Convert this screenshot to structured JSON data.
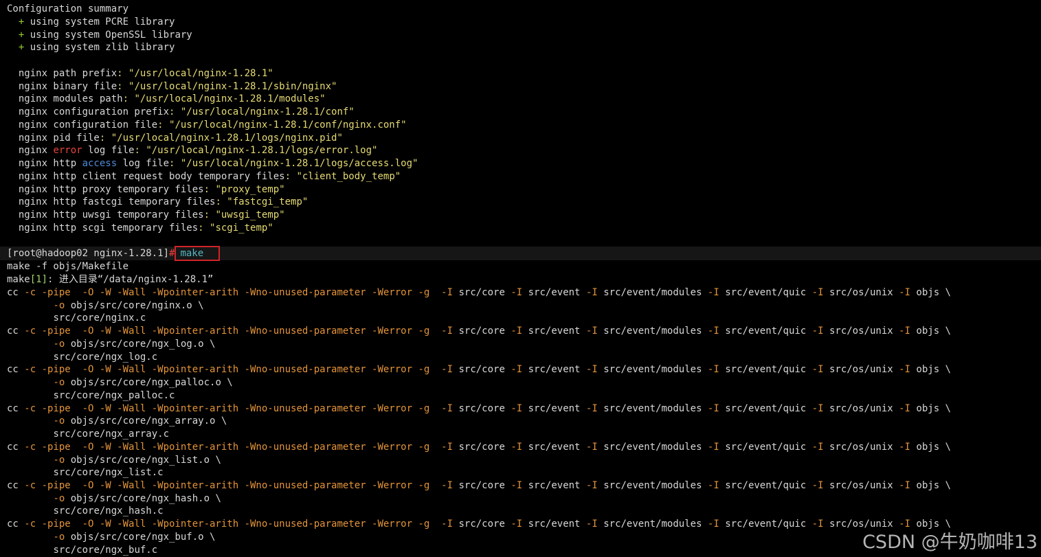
{
  "summary": {
    "title": "Configuration summary",
    "plus": "+",
    "libs": [
      "using system PCRE library",
      "using system OpenSSL library",
      "using system zlib library"
    ]
  },
  "config": {
    "path_prefix_label": "nginx path prefix",
    "path_prefix_value": "\"/usr/local/nginx-1.28.1\"",
    "binary_label": "nginx binary file",
    "binary_value": "\"/usr/local/nginx-1.28.1/sbin/nginx\"",
    "modules_label": "nginx modules path",
    "modules_value": "\"/usr/local/nginx-1.28.1/modules\"",
    "conf_prefix_label": "nginx configuration prefix",
    "conf_prefix_value": "\"/usr/local/nginx-1.28.1/conf\"",
    "conf_file_label": "nginx configuration file",
    "conf_file_value": "\"/usr/local/nginx-1.28.1/conf/nginx.conf\"",
    "pid_label": "nginx pid file",
    "pid_value": "\"/usr/local/nginx-1.28.1/logs/nginx.pid\"",
    "error_pre": "nginx ",
    "error_word": "error",
    "error_post": " log file",
    "error_value": "\"/usr/local/nginx-1.28.1/logs/error.log\"",
    "access_pre": "nginx http ",
    "access_word": "access",
    "access_post": " log file",
    "access_value": "\"/usr/local/nginx-1.28.1/logs/access.log\"",
    "client_body_label": "nginx http client request body temporary files",
    "client_body_value": "\"client_body_temp\"",
    "proxy_label": "nginx http proxy temporary files",
    "proxy_value": "\"proxy_temp\"",
    "fastcgi_label": "nginx http fastcgi temporary files",
    "fastcgi_value": "\"fastcgi_temp\"",
    "uwsgi_label": "nginx http uwsgi temporary files",
    "uwsgi_value": "\"uwsgi_temp\"",
    "scgi_label": "nginx http scgi temporary files",
    "scgi_value": "\"scgi_temp\""
  },
  "prompt": {
    "text": "[root@hadoop02 nginx-1.28.1]",
    "hash": "#",
    "command": "make"
  },
  "make_output": {
    "line1": "make -f objs/Makefile",
    "line2_pre": "make",
    "line2_num": "[1]",
    "line2_post": ": 进入目录“/data/nginx-1.28.1”"
  },
  "compile": {
    "cc": "cc",
    "flags": " -c -pipe  -O -W -Wall -Wpointer-arith -Wno-unused-parameter -Werror -g ",
    "I": " -I",
    "inc_core": " src/core",
    "inc_event": " src/event",
    "inc_modules": " src/event/modules",
    "inc_quic": " src/event/quic",
    "inc_unix": " src/os/unix",
    "inc_objs": " objs \\",
    "o_flag": "-o",
    "units": [
      {
        "obj": " objs/src/core/nginx.o \\",
        "src": "src/core/nginx.c"
      },
      {
        "obj": " objs/src/core/ngx_log.o \\",
        "src": "src/core/ngx_log.c"
      },
      {
        "obj": " objs/src/core/ngx_palloc.o \\",
        "src": "src/core/ngx_palloc.c"
      },
      {
        "obj": " objs/src/core/ngx_array.o \\",
        "src": "src/core/ngx_array.c"
      },
      {
        "obj": " objs/src/core/ngx_list.o \\",
        "src": "src/core/ngx_list.c"
      },
      {
        "obj": " objs/src/core/ngx_hash.o \\",
        "src": "src/core/ngx_hash.c"
      },
      {
        "obj": " objs/src/core/ngx_buf.o \\",
        "src": "src/core/ngx_buf.c"
      }
    ]
  },
  "watermark": "CSDN @牛奶咖啡13"
}
